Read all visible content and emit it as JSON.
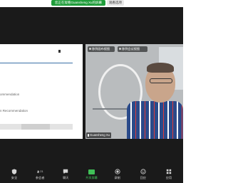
{
  "banner": {
    "sharing_text": "您正在观看Guansheng Xu的屏幕",
    "stop_label": "观看选项"
  },
  "video": {
    "overlay_buttons": [
      {
        "label": "移到画布视图"
      },
      {
        "label": "移到会议视图"
      }
    ],
    "participant_name": "Guansheng Xu"
  },
  "shared_screen": {
    "line_1": "ommendation",
    "line_2": "n Recommendation"
  },
  "toolbar": {
    "items": [
      {
        "label": "安全",
        "icon": "shield-icon"
      },
      {
        "label": "参会者",
        "icon": "participants-icon",
        "count": "21"
      },
      {
        "label": "聊天",
        "icon": "chat-icon"
      },
      {
        "label": "共享屏幕",
        "icon": "share-screen-icon"
      },
      {
        "label": "录制",
        "icon": "record-icon"
      },
      {
        "label": "回应",
        "icon": "reactions-icon"
      },
      {
        "label": "应用",
        "icon": "apps-icon"
      }
    ]
  },
  "colors": {
    "accent_green": "#1f9d3a",
    "share_green": "#40c057",
    "background_dark": "#1a1a1a"
  }
}
